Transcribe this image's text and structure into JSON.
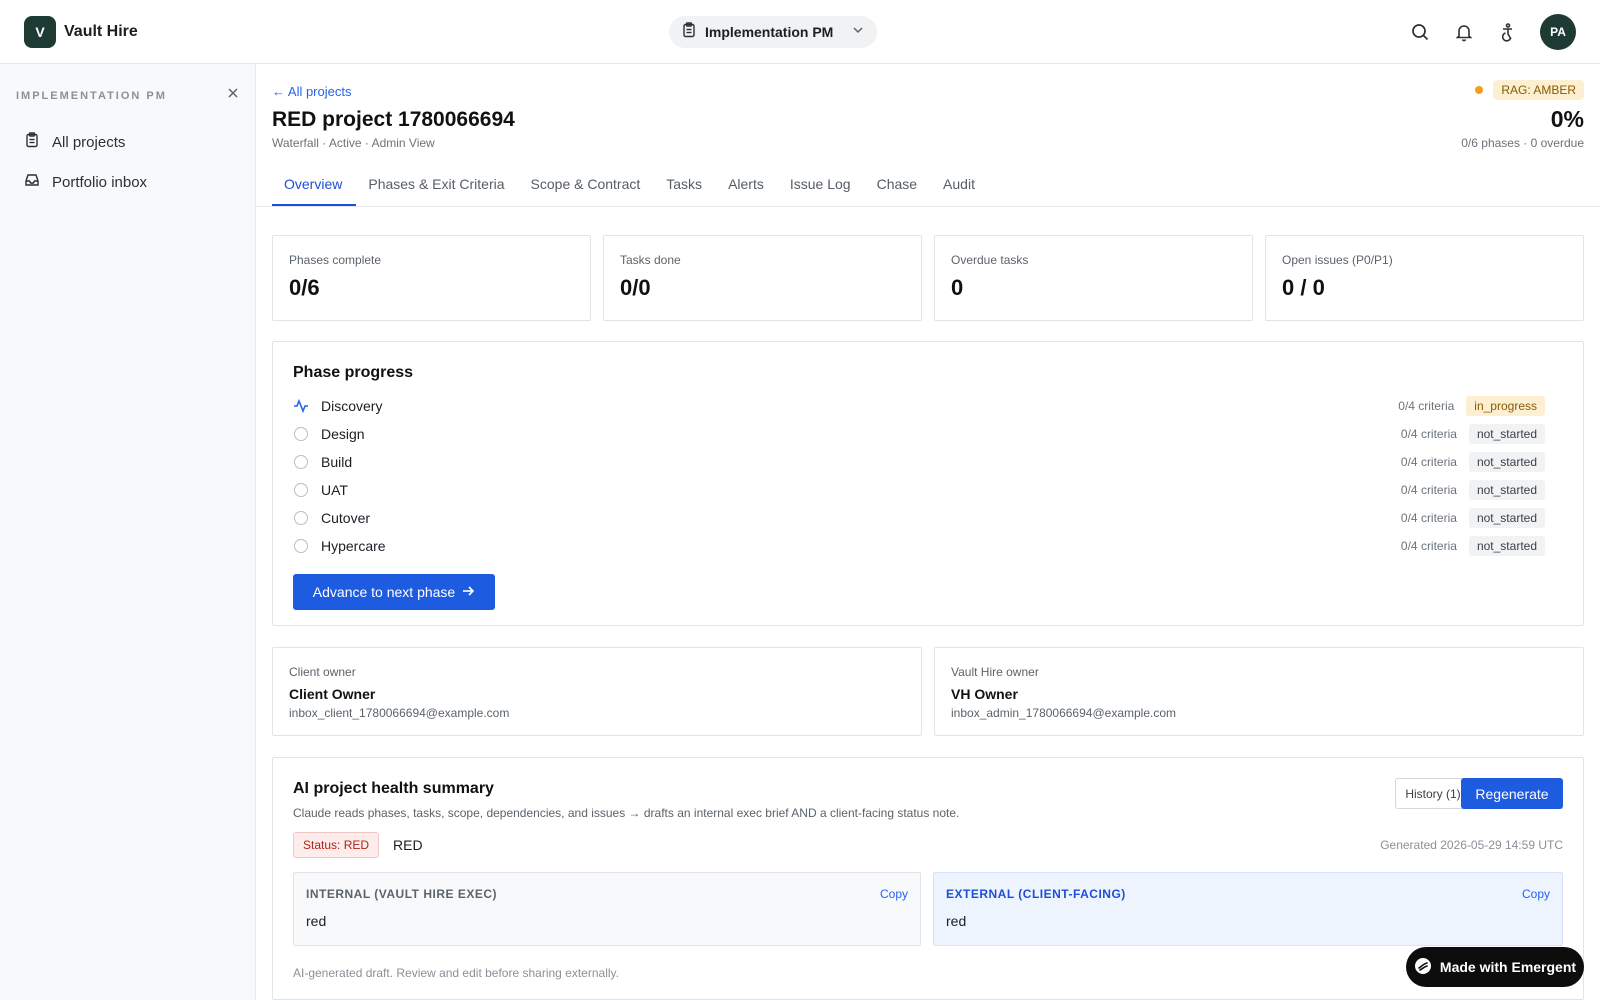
{
  "app": {
    "logo_letter": "V",
    "name": "Vault Hire"
  },
  "header": {
    "role_label": "Implementation PM",
    "avatar_initials": "PA",
    "icons": [
      "search-icon",
      "bell-icon",
      "accessibility-icon",
      "chevron-down-icon"
    ]
  },
  "sidebar": {
    "title": "IMPLEMENTATION PM",
    "items": [
      {
        "label": "All projects",
        "icon": "clipboard-icon"
      },
      {
        "label": "Portfolio inbox",
        "icon": "inbox-icon"
      }
    ]
  },
  "project": {
    "back_link": "← All projects",
    "title": "RED project 1780066694",
    "meta": "Waterfall · Active · Admin View",
    "rag": "RAG: AMBER",
    "rag_color": "#f29d1f",
    "percent": "0%",
    "percent_sub": "0/6 phases · 0 overdue"
  },
  "tabs": [
    {
      "label": "Overview",
      "active": true
    },
    {
      "label": "Phases & Exit Criteria"
    },
    {
      "label": "Scope & Contract"
    },
    {
      "label": "Tasks"
    },
    {
      "label": "Alerts"
    },
    {
      "label": "Issue Log"
    },
    {
      "label": "Chase"
    },
    {
      "label": "Audit"
    }
  ],
  "stats": [
    {
      "label": "Phases complete",
      "value": "0/6"
    },
    {
      "label": "Tasks done",
      "value": "0/0"
    },
    {
      "label": "Overdue tasks",
      "value": "0"
    },
    {
      "label": "Open issues (P0/P1)",
      "value": "0 / 0"
    }
  ],
  "phase_progress": {
    "title": "Phase progress",
    "phases": [
      {
        "name": "Discovery",
        "criteria": "0/4 criteria",
        "status": "in_progress"
      },
      {
        "name": "Design",
        "criteria": "0/4 criteria",
        "status": "not_started"
      },
      {
        "name": "Build",
        "criteria": "0/4 criteria",
        "status": "not_started"
      },
      {
        "name": "UAT",
        "criteria": "0/4 criteria",
        "status": "not_started"
      },
      {
        "name": "Cutover",
        "criteria": "0/4 criteria",
        "status": "not_started"
      },
      {
        "name": "Hypercare",
        "criteria": "0/4 criteria",
        "status": "not_started"
      }
    ],
    "advance_label": "Advance to next phase"
  },
  "owners": {
    "client": {
      "label": "Client owner",
      "name": "Client Owner",
      "email": "inbox_client_1780066694@example.com"
    },
    "vh": {
      "label": "Vault Hire owner",
      "name": "VH Owner",
      "email": "inbox_admin_1780066694@example.com"
    }
  },
  "ai_summary": {
    "title": "AI project health summary",
    "subtitle": "Claude reads phases, tasks, scope, dependencies, and issues → drafts an internal exec brief AND a client-facing status note.",
    "history_label": "History (1)",
    "regenerate_label": "Regenerate",
    "status_badge": "Status: RED",
    "status_text": "RED",
    "generated": "Generated 2026-05-29 14:59 UTC",
    "internal": {
      "heading": "INTERNAL (VAULT HIRE EXEC)",
      "copy": "Copy",
      "body": "red"
    },
    "external": {
      "heading": "EXTERNAL (CLIENT-FACING)",
      "copy": "Copy",
      "body": "red"
    },
    "footer": "AI-generated draft. Review and edit before sharing externally."
  },
  "badge": {
    "label": "Made with Emergent"
  }
}
